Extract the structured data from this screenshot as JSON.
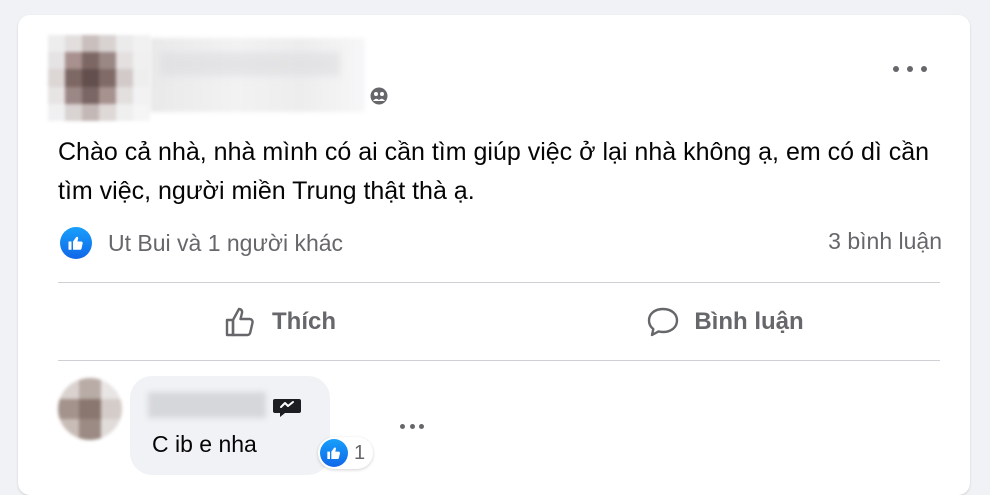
{
  "post": {
    "text": "Chào cả nhà, nhà mình có ai cần tìm giúp việc ở lại nhà không ạ, em có dì cần tìm việc, người miền Trung thật thà ạ.",
    "reaction_summary": "Ut Bui và 1 người khác",
    "comment_count": "3 bình luận",
    "privacy_icon": "friends-icon",
    "menu_icon": "more-horizontal-icon"
  },
  "actions": {
    "like_label": "Thích",
    "like_icon": "thumbs-up-outline-icon",
    "comment_label": "Bình luận",
    "comment_icon": "speech-bubble-icon"
  },
  "comment": {
    "text": "C ib e nha",
    "reaction_count": "1",
    "reaction_icon": "like-icon",
    "menu_icon": "more-horizontal-icon"
  },
  "colors": {
    "background": "#f0f2f5",
    "card": "#ffffff",
    "secondary_text": "#65676b",
    "like_blue": "#1877f2"
  }
}
